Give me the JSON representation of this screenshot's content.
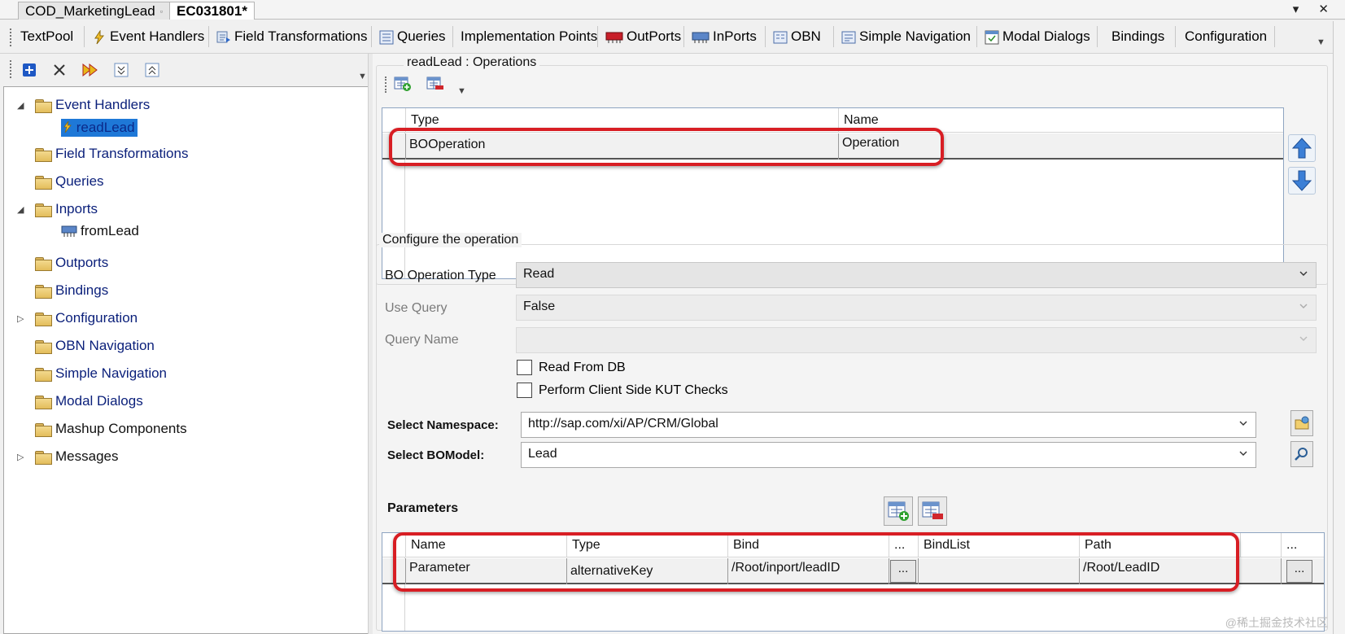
{
  "doc_tabs": {
    "items": [
      {
        "label": "COD_MarketingLead",
        "active": false
      },
      {
        "label": "EC031801*",
        "active": true
      }
    ],
    "controls": "▾ ✕"
  },
  "designer_tabs": [
    {
      "label": "TextPool",
      "icon": "none"
    },
    {
      "label": "Event Handlers",
      "icon": "lightning-icon"
    },
    {
      "label": "Field Transformations",
      "icon": "transform-icon"
    },
    {
      "label": "Queries",
      "icon": "query-icon"
    },
    {
      "label": "Implementation Points",
      "icon": "none"
    },
    {
      "label": "OutPorts",
      "icon": "outport-icon"
    },
    {
      "label": "InPorts",
      "icon": "inport-icon"
    },
    {
      "label": "OBN",
      "icon": "obn-icon"
    },
    {
      "label": "Simple Navigation",
      "icon": "navigation-icon"
    },
    {
      "label": "Modal Dialogs",
      "icon": "dialog-icon"
    },
    {
      "label": "Bindings",
      "icon": "none"
    },
    {
      "label": "Configuration",
      "icon": "none"
    }
  ],
  "tree": {
    "nodes": [
      {
        "label": "Event Handlers",
        "expander": "◢",
        "level": 0
      },
      {
        "label": "readLead",
        "level": 1,
        "selected": true
      },
      {
        "label": "Field Transformations",
        "level": 0
      },
      {
        "label": "Queries",
        "level": 0
      },
      {
        "label": "Inports",
        "expander": "◢",
        "level": 0
      },
      {
        "label": "fromLead",
        "level": 1
      },
      {
        "label": "Outports",
        "level": 0
      },
      {
        "label": "Bindings",
        "level": 0
      },
      {
        "label": "Configuration",
        "expander": "▷",
        "level": 0
      },
      {
        "label": "OBN Navigation",
        "level": 0
      },
      {
        "label": "Simple Navigation",
        "level": 0
      },
      {
        "label": "Modal Dialogs",
        "level": 0
      },
      {
        "label": "Mashup Components",
        "level": 0
      },
      {
        "label": "Messages",
        "expander": "▷",
        "level": 0
      }
    ]
  },
  "operations": {
    "title": "readLead : Operations",
    "columns": [
      "Type",
      "Name"
    ],
    "rows": [
      {
        "type": "BOOperation",
        "name": "Operation"
      }
    ]
  },
  "configure": {
    "title": "Configure the operation",
    "bo_operation_type_label": "BO Operation Type",
    "bo_operation_type_value": "Read",
    "use_query_label": "Use Query",
    "use_query_value": "False",
    "query_name_label": "Query Name",
    "query_name_value": "",
    "read_from_db_label": "Read From DB",
    "kut_checks_label": "Perform Client Side KUT Checks",
    "namespace_label": "Select Namespace:",
    "namespace_value": "http://sap.com/xi/AP/CRM/Global",
    "bomodel_label": "Select BOModel:",
    "bomodel_value": "Lead"
  },
  "parameters": {
    "title": "Parameters",
    "columns": [
      "Name",
      "Type",
      "Bind",
      "...",
      "BindList",
      "Path",
      "..."
    ],
    "rows": [
      {
        "name": "Parameter",
        "type": "alternativeKey",
        "bind": "/Root/inport/leadID",
        "btn": "...",
        "bindlist": "",
        "path": "/Root/LeadID",
        "btn2": "..."
      }
    ]
  },
  "watermark": "@稀土掘金技术社区",
  "colors": {
    "highlight": "#d81e24",
    "selection": "#1e78d7",
    "tree_text": "#0a1f7a"
  }
}
